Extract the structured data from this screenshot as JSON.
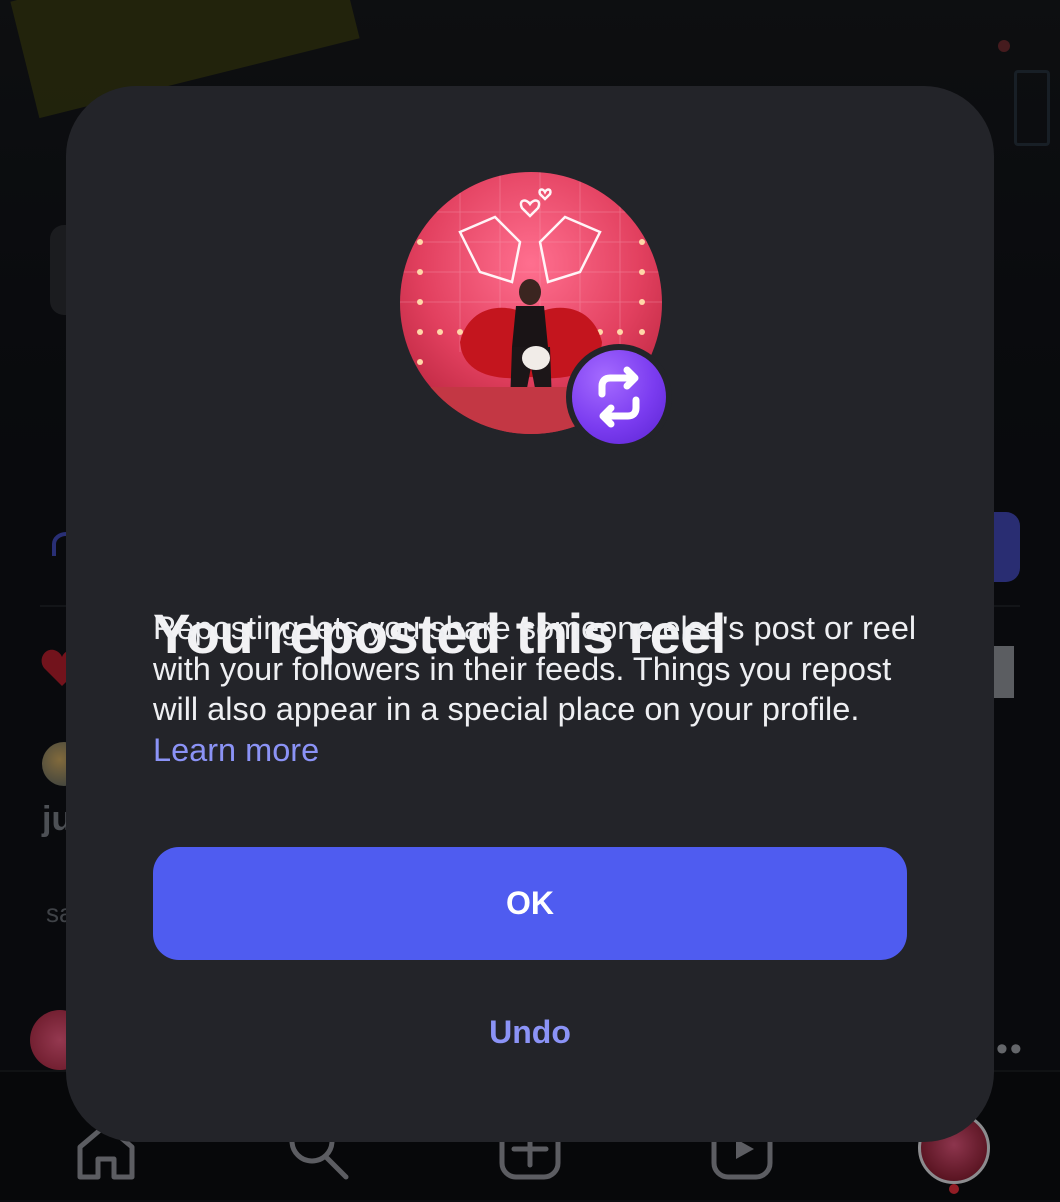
{
  "dialog": {
    "title": "You reposted this reel",
    "body": "Reposting lets you share someone else's post or reel with your followers in their feeds. Things you repost will also appear in a special place on your profile.",
    "learn_more": "Learn more",
    "ok_label": "OK",
    "undo_label": "Undo",
    "badge_icon": "repost-icon",
    "thumbnail": "reel-thumbnail"
  },
  "background": {
    "partial_username": "ju",
    "partial_caption": "sa",
    "more_label": "••"
  },
  "bottom_nav": {
    "items": [
      {
        "icon": "home-icon"
      },
      {
        "icon": "search-icon"
      },
      {
        "icon": "create-icon"
      },
      {
        "icon": "reels-icon"
      },
      {
        "icon": "profile-avatar"
      }
    ]
  },
  "colors": {
    "dialog_bg": "#232429",
    "primary": "#4f5cf0",
    "link": "#8b93f6",
    "badge": "#7b3cf0",
    "notification_dot": "#e12d3a"
  }
}
